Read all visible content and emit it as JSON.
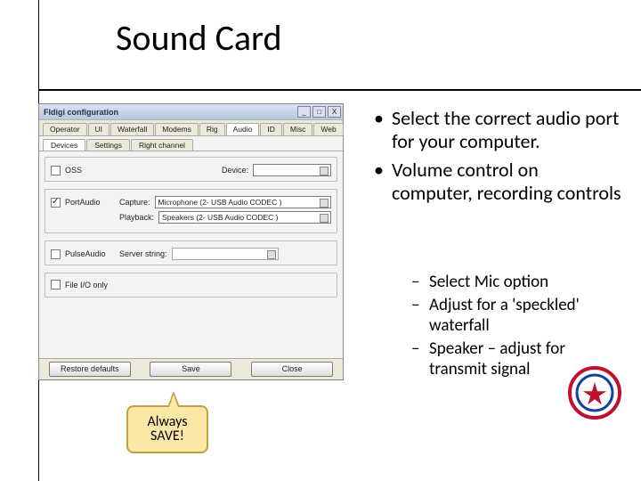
{
  "title": "Sound Card",
  "bullets": [
    "Select the correct audio port for your computer.",
    "Volume control on computer, recording controls"
  ],
  "subbullets": [
    "Select Mic option",
    "Adjust for a 'speckled' waterfall",
    "Speaker – adjust for transmit signal"
  ],
  "callout": {
    "line1": "Always",
    "line2": "SAVE!"
  },
  "dialog": {
    "caption": "Fldigi configuration",
    "win": {
      "min": "_",
      "max": "□",
      "close": "X"
    },
    "tabs": [
      "Operator",
      "UI",
      "Waterfall",
      "Modems",
      "Rig",
      "Audio",
      "ID",
      "Misc",
      "Web"
    ],
    "tabs_active": "Audio",
    "subtabs": [
      "Devices",
      "Settings",
      "Right channel"
    ],
    "subtabs_active": "Devices",
    "oss": {
      "label": "OSS",
      "device_label": "Device:",
      "device": ""
    },
    "port": {
      "label": "PortAudio",
      "capture_label": "Capture:",
      "capture": "Microphone (2- USB Audio CODEC )",
      "playback_label": "Playback:",
      "playback": "Speakers (2- USB Audio CODEC )"
    },
    "pulse": {
      "label": "PulseAudio",
      "server_label": "Server string:",
      "server": ""
    },
    "fileio": {
      "label": "File I/O only"
    },
    "buttons": {
      "restore": "Restore defaults",
      "save": "Save",
      "close": "Close"
    }
  }
}
